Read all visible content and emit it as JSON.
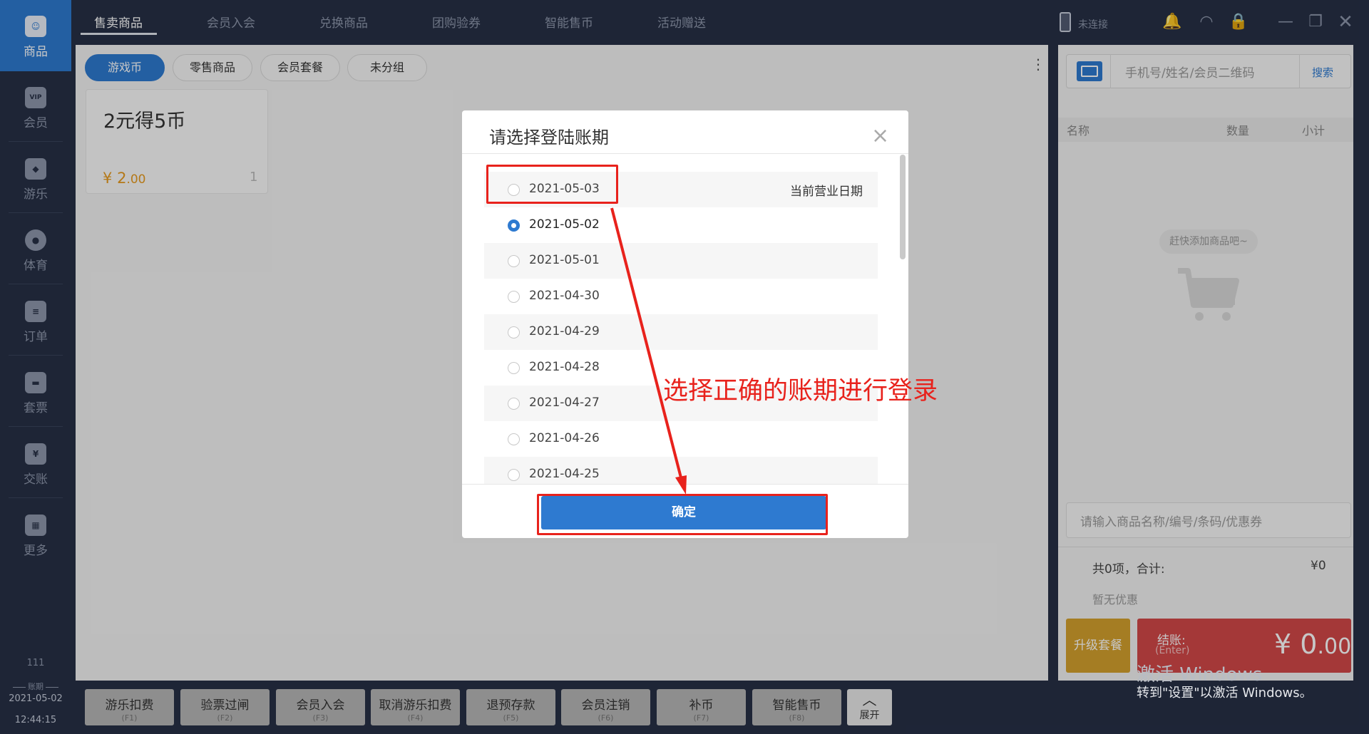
{
  "sidebar": {
    "items": [
      {
        "label": "商品",
        "icon": "☺"
      },
      {
        "label": "会员",
        "icon": "VIP"
      },
      {
        "label": "游乐",
        "icon": "◆"
      },
      {
        "label": "体育",
        "icon": "●"
      },
      {
        "label": "订单",
        "icon": "≡"
      },
      {
        "label": "套票",
        "icon": "▬"
      },
      {
        "label": "交账",
        "icon": "¥"
      },
      {
        "label": "更多",
        "icon": "▦"
      }
    ],
    "number": "111",
    "period_caption": "账期",
    "date": "2021-05-02",
    "time": "12:44:15"
  },
  "top_tabs": [
    "售卖商品",
    "会员入会",
    "兑换商品",
    "团购验券",
    "智能售币",
    "活动赠送"
  ],
  "top_right": {
    "connection": "未连接",
    "icons": [
      "bell-icon",
      "headset-icon",
      "lock-icon",
      "minimize-icon",
      "restore-icon",
      "close-icon"
    ]
  },
  "categories": [
    "游戏币",
    "零售商品",
    "会员套餐",
    "未分组"
  ],
  "product": {
    "name": "2元得5币",
    "price_symbol": "¥",
    "price_int": "2",
    "price_dec": ".00",
    "count": "1"
  },
  "right_panel": {
    "search_placeholder": "手机号/姓名/会员二维码",
    "search_button": "搜索",
    "cols": [
      "名称",
      "数量",
      "小计"
    ],
    "empty_hint": "赶快添加商品吧~",
    "item_placeholder": "请输入商品名称/编号/条码/优惠券",
    "summary_label": "共0项，合计:",
    "summary_value": "¥0",
    "discount": "暂无优惠",
    "upgrade": "升级套餐",
    "checkout_label": "结账:",
    "checkout_key": "(Enter)",
    "checkout_symbol": "¥",
    "checkout_int": "0",
    "checkout_dec": ".00"
  },
  "watermark": {
    "line1": "激活 Windows",
    "line2": "转到\"设置\"以激活 Windows。"
  },
  "bottom_buttons": [
    {
      "label": "游乐扣费",
      "key": "(F1)"
    },
    {
      "label": "验票过闸",
      "key": "(F2)"
    },
    {
      "label": "会员入会",
      "key": "(F3)"
    },
    {
      "label": "取消游乐扣费",
      "key": "(F4)"
    },
    {
      "label": "退预存款",
      "key": "(F5)"
    },
    {
      "label": "会员注销",
      "key": "(F6)"
    },
    {
      "label": "补币",
      "key": "(F7)"
    },
    {
      "label": "智能售币",
      "key": "(F8)"
    }
  ],
  "expand_label": "展开",
  "dialog": {
    "title": "请选择登陆账期",
    "dates": [
      "2021-05-03",
      "2021-05-02",
      "2021-05-01",
      "2021-04-30",
      "2021-04-29",
      "2021-04-28",
      "2021-04-27",
      "2021-04-26",
      "2021-04-25"
    ],
    "selected_index": 1,
    "current_note": "当前营业日期",
    "confirm": "确定"
  },
  "annotation": {
    "text": "选择正确的账期进行登录",
    "color": "#e8221c"
  },
  "colors": {
    "accent": "#2e7ad0",
    "checkout": "#d24848",
    "upgrade": "#d4a02e",
    "price": "#e79a1e"
  }
}
